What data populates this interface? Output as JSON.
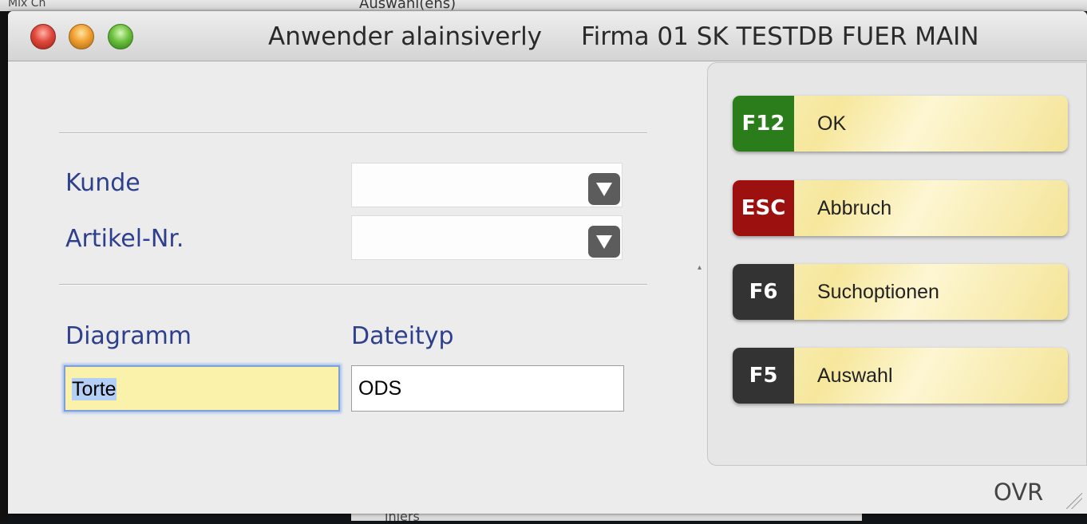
{
  "background": {
    "top_fragment_left": "Mix Ch",
    "top_fragment_right": "Auswahl(ens)",
    "bottom_fragment": "lnlers"
  },
  "titlebar": {
    "user": "Anwender alainsiverly",
    "firm": "Firma 01 SK TESTDB FUER MAIN"
  },
  "form": {
    "kunde_label": "Kunde",
    "artikel_label": "Artikel-Nr.",
    "kunde_value": "",
    "artikel_value": "",
    "diagramm_label": "Diagramm",
    "dateityp_label": "Dateityp",
    "diagramm_value": "Torte",
    "dateityp_value": "ODS"
  },
  "actions": [
    {
      "key": "F12",
      "label": "OK",
      "color": "#2b7d1c"
    },
    {
      "key": "ESC",
      "label": "Abbruch",
      "color": "#9c1010"
    },
    {
      "key": "F6",
      "label": "Suchoptionen",
      "color": "#333333"
    },
    {
      "key": "F5",
      "label": "Auswahl",
      "color": "#333333"
    }
  ],
  "status": {
    "mode": "OVR"
  },
  "icons": {
    "close": "close-icon",
    "minimize": "minimize-icon",
    "zoom": "zoom-icon",
    "dropdown": "chevron-down-icon",
    "resize": "resize-grip-icon"
  }
}
